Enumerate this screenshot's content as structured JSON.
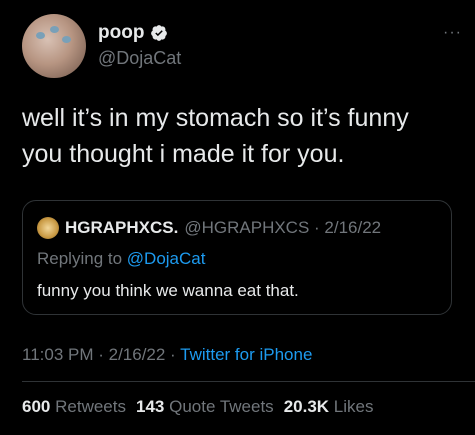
{
  "author": {
    "display_name": "poop",
    "handle": "@DojaCat",
    "more_label": "···"
  },
  "tweet": {
    "line1": "well it’s in my stomach so it’s funny",
    "line2": "you thought i made it for you."
  },
  "quote": {
    "display_name": "HGRAPHXCS.",
    "handle_date": "@HGRAPHXCS · 2/16/22",
    "replying_prefix": "Replying to ",
    "replying_to": "@DojaCat",
    "text": "funny you think we wanna eat that."
  },
  "meta": {
    "time_date": "11:03 PM · 2/16/22 · ",
    "source": "Twitter for iPhone"
  },
  "stats": {
    "retweets_count": "600",
    "retweets_label": "Retweets",
    "quotes_count": "143",
    "quotes_label": "Quote Tweets",
    "likes_count": "20.3K",
    "likes_label": "Likes"
  },
  "colors": {
    "background": "#000000",
    "text": "#e7e9ea",
    "secondary": "#71767b",
    "accent": "#1d9bf0",
    "border": "#2f3336"
  }
}
